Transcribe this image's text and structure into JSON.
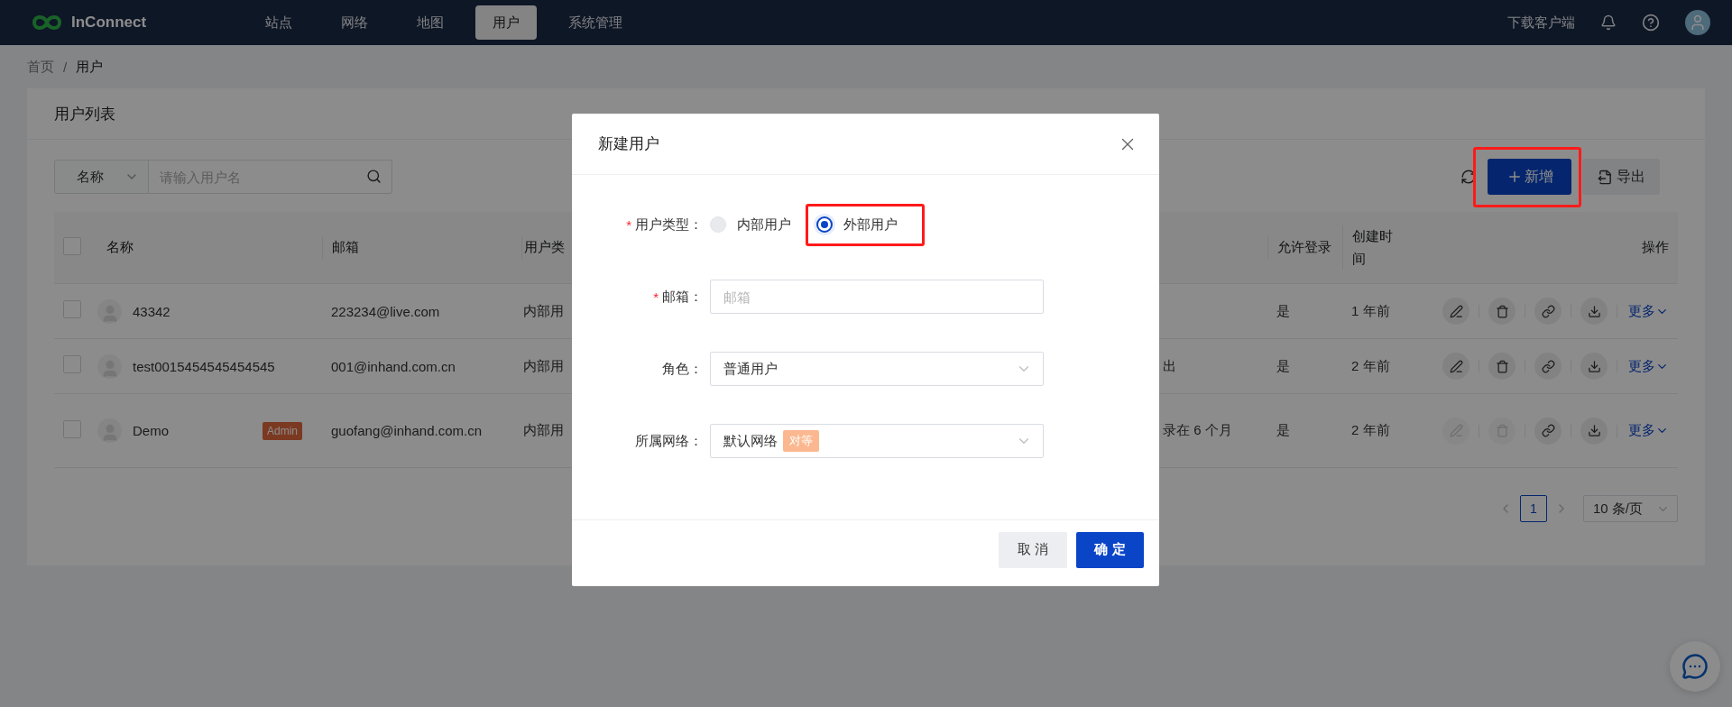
{
  "nav": {
    "logo_text": "InConnect",
    "items": [
      {
        "label": "站点",
        "selected": false
      },
      {
        "label": "网络",
        "selected": false
      },
      {
        "label": "地图",
        "selected": false
      },
      {
        "label": "用户",
        "selected": true
      },
      {
        "label": "系统管理",
        "selected": false
      }
    ],
    "download_label": "下载客户端"
  },
  "breadcrumb": [
    {
      "kind": "link",
      "text": "首页"
    },
    {
      "kind": "separator",
      "text": "/"
    },
    {
      "kind": "current",
      "text": "用户"
    }
  ],
  "card": {
    "title": "用户列表",
    "search": {
      "filter": "名称",
      "placeholder": "请输入用户名"
    },
    "toolbar": {
      "add_button": {
        "label": "新增",
        "highlighted": true
      },
      "export_button": {
        "label": "导出"
      }
    },
    "table": {
      "select_all": {
        "checked": false
      },
      "columns": [
        {
          "label": "名称"
        },
        {
          "label": "邮箱"
        },
        {
          "label": "用户类"
        },
        {
          "label": "允许登录"
        },
        {
          "label": "创建时间"
        },
        {
          "label": "操作"
        }
      ],
      "rows": [
        {
          "checked": false,
          "name": "43342",
          "email": "223234@live.com",
          "type": "内部用",
          "allow_login": "是",
          "created": "1 年前",
          "actions_disabled": false,
          "more": "更多"
        },
        {
          "checked": false,
          "name": "test0015454545454545",
          "email": "001@inhand.com.cn",
          "type": "内部用",
          "column_4": "出",
          "allow_login": "是",
          "created": "2 年前",
          "actions_disabled": false,
          "more": "更多"
        },
        {
          "checked": false,
          "name": "Demo",
          "badge": "Admin",
          "email": "guofang@inhand.com.cn",
          "type": "内部用",
          "column_4": "录在 6 个月",
          "allow_login": "是",
          "created": "2 年前",
          "actions_disabled": true,
          "more": "更多"
        }
      ]
    },
    "pagination": {
      "pages": [
        {
          "label": "1",
          "selected": true
        }
      ],
      "page_size": "10 条/页"
    }
  },
  "modal": {
    "title": "新建用户",
    "fields": [
      {
        "kind": "radio",
        "label": "用户类型：",
        "required_mark": "*",
        "options": [
          {
            "label": "内部用户",
            "selected": false
          },
          {
            "label": "外部用户",
            "selected": true,
            "highlighted": true
          }
        ]
      },
      {
        "kind": "input",
        "label": "邮箱：",
        "required_mark": "*",
        "placeholder": "邮箱"
      },
      {
        "kind": "select",
        "label": "角色：",
        "value": "普通用户"
      },
      {
        "kind": "select",
        "label": "所属网络：",
        "value": "默认网络",
        "tag": "对等"
      }
    ],
    "cancel_button": "取 消",
    "ok_button": "确 定"
  }
}
